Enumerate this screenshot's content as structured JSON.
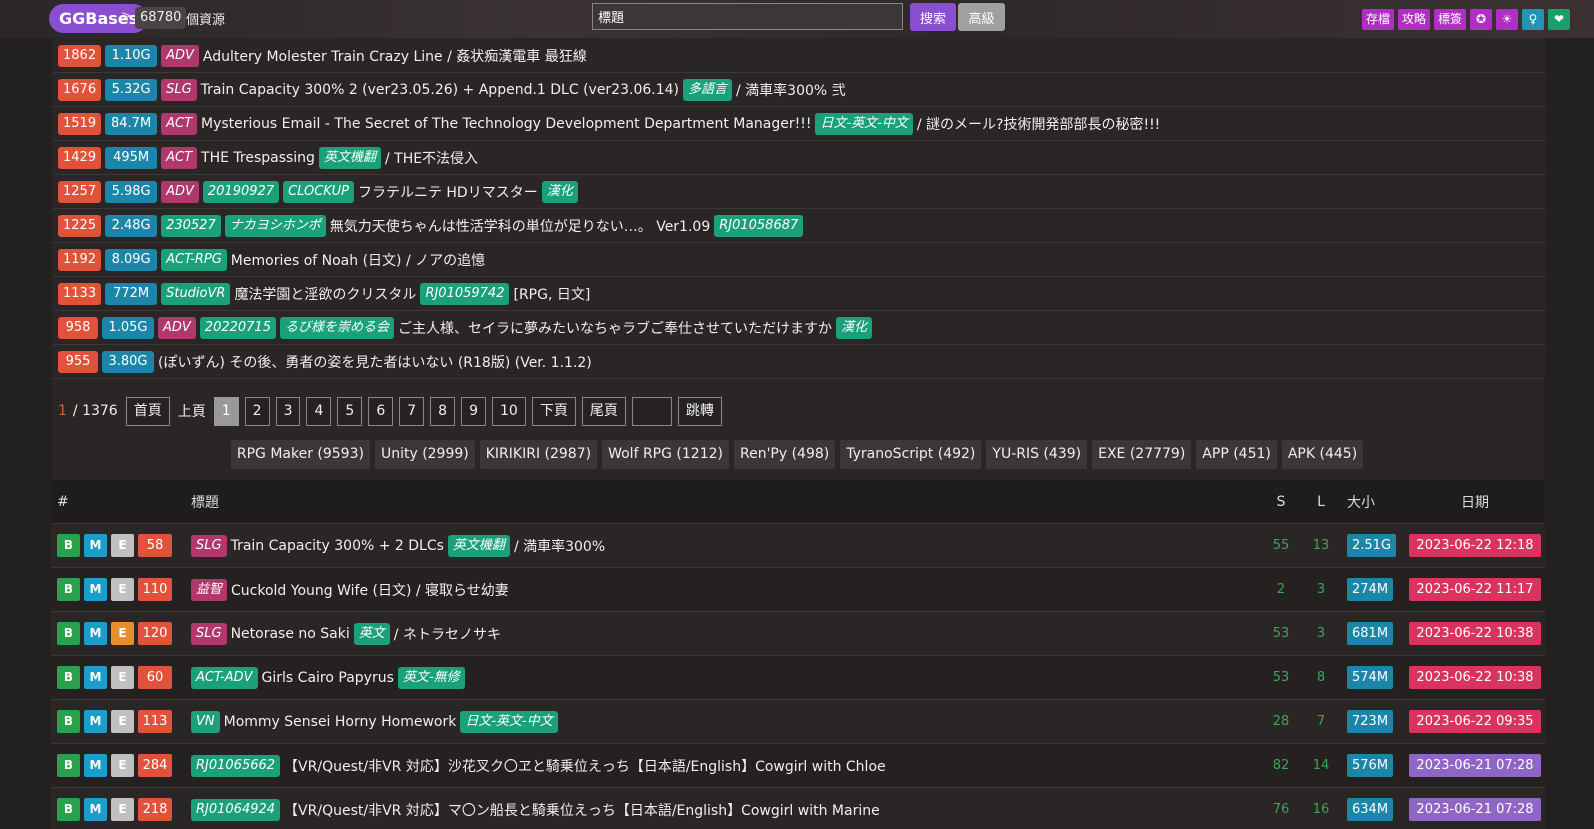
{
  "header": {
    "brand": "GGBases",
    "crumb_sep": ">",
    "resource_count": "68780",
    "resource_label": "個資源",
    "search": {
      "value": "標題",
      "placeholder": ""
    },
    "search_label": "搜索",
    "advanced_label": "高級",
    "right_buttons": [
      {
        "label": "存檔",
        "icon": "archive"
      },
      {
        "label": "攻略",
        "icon": "guide"
      },
      {
        "label": "標簽",
        "icon": "tags"
      },
      {
        "label": "✪",
        "icon": "star-circle-icon"
      },
      {
        "label": "☀",
        "icon": "sun-icon"
      },
      {
        "label": "♀",
        "icon": "female-icon"
      },
      {
        "label": "❤",
        "icon": "heart-icon"
      }
    ]
  },
  "top_list": [
    {
      "count": "1862",
      "size": "1.10G",
      "tags": [
        {
          "t": "ADV",
          "c": "pink"
        }
      ],
      "title": "Adultery Molester Train Crazy Line / 姦状痴漢電車 最狂線",
      "tags_after": [],
      "tail": ""
    },
    {
      "count": "1676",
      "size": "5.32G",
      "tags": [
        {
          "t": "SLG",
          "c": "pink"
        }
      ],
      "title": "Train Capacity 300% 2 (ver23.05.26) + Append.1 DLC (ver23.06.14)",
      "tags_after": [
        {
          "t": "多語言",
          "c": "green"
        }
      ],
      "tail": "/ 満車率300% 弐"
    },
    {
      "count": "1519",
      "size": "84.7M",
      "tags": [
        {
          "t": "ACT",
          "c": "pink"
        }
      ],
      "title": "Mysterious Email - The Secret of The Technology Development Department Manager!!!",
      "tags_after": [
        {
          "t": "日文-英文-中文",
          "c": "green"
        }
      ],
      "tail": "/ 謎のメール?技術開発部部長の秘密!!!"
    },
    {
      "count": "1429",
      "size": "495M",
      "tags": [
        {
          "t": "ACT",
          "c": "pink"
        }
      ],
      "title": "THE Trespassing",
      "tags_after": [
        {
          "t": "英文機翻",
          "c": "green"
        }
      ],
      "tail": "/ THE不法侵入"
    },
    {
      "count": "1257",
      "size": "5.98G",
      "tags": [
        {
          "t": "ADV",
          "c": "pink"
        },
        {
          "t": "20190927",
          "c": "green"
        },
        {
          "t": "CLOCKUP",
          "c": "green"
        }
      ],
      "title": "フラテルニテ HDリマスター",
      "tags_after": [
        {
          "t": "漢化",
          "c": "green"
        }
      ],
      "tail": ""
    },
    {
      "count": "1225",
      "size": "2.48G",
      "tags": [
        {
          "t": "230527",
          "c": "green"
        },
        {
          "t": "ナカヨシホンポ",
          "c": "green"
        }
      ],
      "title": "無気力天使ちゃんは性活学科の単位が足りない…。 Ver1.09",
      "tags_after": [
        {
          "t": "RJ01058687",
          "c": "green"
        }
      ],
      "tail": ""
    },
    {
      "count": "1192",
      "size": "8.09G",
      "tags": [
        {
          "t": "ACT-RPG",
          "c": "green"
        }
      ],
      "title": "Memories of Noah (日文) / ノアの追憶",
      "tags_after": [],
      "tail": ""
    },
    {
      "count": "1133",
      "size": "772M",
      "tags": [
        {
          "t": "StudioVR",
          "c": "green"
        }
      ],
      "title": "魔法学園と淫欲のクリスタル",
      "tags_after": [
        {
          "t": "RJ01059742",
          "c": "green"
        }
      ],
      "tail": "[RPG, 日文]"
    },
    {
      "count": "958",
      "size": "1.05G",
      "tags": [
        {
          "t": "ADV",
          "c": "pink"
        },
        {
          "t": "20220715",
          "c": "green"
        },
        {
          "t": "るび様を崇める会",
          "c": "green"
        }
      ],
      "title": "ご主人様、セイラに夢みたいなちゃラブご奉仕させていただけますか",
      "tags_after": [
        {
          "t": "漢化",
          "c": "green"
        }
      ],
      "tail": ""
    },
    {
      "count": "955",
      "size": "3.80G",
      "tags": [],
      "title": "(ぽいずん) その後、勇者の姿を見た者はいない (R18版) (Ver. 1.1.2)",
      "tags_after": [],
      "tail": ""
    }
  ],
  "pager": {
    "current": "1",
    "total": "/ 1376",
    "first": "首頁",
    "prev": "上頁",
    "pages": [
      "1",
      "2",
      "3",
      "4",
      "5",
      "6",
      "7",
      "8",
      "9",
      "10"
    ],
    "next": "下頁",
    "last": "尾頁",
    "jump_value": "",
    "jump": "跳轉"
  },
  "engines": [
    "RPG Maker (9593)",
    "Unity (2999)",
    "KIRIKIRI (2987)",
    "Wolf RPG (1212)",
    "Ren'Py (498)",
    "TyranoScript (492)",
    "YU-RIS (439)",
    "EXE (27779)",
    "APP (451)",
    "APK (445)"
  ],
  "table": {
    "headers": {
      "num": "#",
      "title": "標題",
      "s": "S",
      "l": "L",
      "size": "大小",
      "date": "日期"
    },
    "rows": [
      {
        "b": "B",
        "m": "M",
        "e": "E",
        "e_orange": false,
        "count": "58",
        "tags": [
          {
            "t": "SLG",
            "c": "pink"
          }
        ],
        "title": "Train Capacity 300% + 2 DLCs",
        "tags_after": [
          {
            "t": "英文機翻",
            "c": "green"
          }
        ],
        "tail": "/ 満車率300%",
        "s": "55",
        "l": "13",
        "size": "2.51G",
        "date": "2023-06-22 12:18",
        "date_color": "pink"
      },
      {
        "b": "B",
        "m": "M",
        "e": "E",
        "e_orange": false,
        "count": "110",
        "tags": [
          {
            "t": "益智",
            "c": "pink"
          }
        ],
        "title": "Cuckold Young Wife (日文) / 寝取らせ幼妻",
        "tags_after": [],
        "tail": "",
        "s": "2",
        "l": "3",
        "size": "274M",
        "date": "2023-06-22 11:17",
        "date_color": "pink"
      },
      {
        "b": "B",
        "m": "M",
        "e": "E",
        "e_orange": true,
        "count": "120",
        "tags": [
          {
            "t": "SLG",
            "c": "pink"
          }
        ],
        "title": "Netorase no Saki",
        "tags_after": [
          {
            "t": "英文",
            "c": "green"
          }
        ],
        "tail": "/ ネトラセノサキ",
        "s": "53",
        "l": "3",
        "size": "681M",
        "date": "2023-06-22 10:38",
        "date_color": "pink"
      },
      {
        "b": "B",
        "m": "M",
        "e": "E",
        "e_orange": false,
        "count": "60",
        "tags": [
          {
            "t": "ACT-ADV",
            "c": "green"
          }
        ],
        "title": "Girls Cairo Papyrus",
        "tags_after": [
          {
            "t": "英文-無修",
            "c": "green"
          }
        ],
        "tail": "",
        "s": "53",
        "l": "8",
        "size": "574M",
        "date": "2023-06-22 10:38",
        "date_color": "pink"
      },
      {
        "b": "B",
        "m": "M",
        "e": "E",
        "e_orange": false,
        "count": "113",
        "tags": [
          {
            "t": "VN",
            "c": "green"
          }
        ],
        "title": "Mommy Sensei Horny Homework",
        "tags_after": [
          {
            "t": "日文-英文-中文",
            "c": "green"
          }
        ],
        "tail": "",
        "s": "28",
        "l": "7",
        "size": "723M",
        "date": "2023-06-22 09:35",
        "date_color": "pink"
      },
      {
        "b": "B",
        "m": "M",
        "e": "E",
        "e_orange": false,
        "count": "284",
        "tags": [
          {
            "t": "RJ01065662",
            "c": "green"
          }
        ],
        "title": "【VR/Quest/非VR 対応】沙花叉ク〇ヱと騎乗位えっち【日本語/English】Cowgirl with Chloe",
        "tags_after": [],
        "tail": "",
        "s": "82",
        "l": "14",
        "size": "576M",
        "date": "2023-06-21 07:28",
        "date_color": "purple"
      },
      {
        "b": "B",
        "m": "M",
        "e": "E",
        "e_orange": false,
        "count": "218",
        "tags": [
          {
            "t": "RJ01064924",
            "c": "green"
          }
        ],
        "title": "【VR/Quest/非VR 対応】マ〇ン船長と騎乗位えっち【日本語/English】Cowgirl with Marine",
        "tags_after": [],
        "tail": "",
        "s": "76",
        "l": "16",
        "size": "634M",
        "date": "2023-06-21 07:28",
        "date_color": "purple"
      }
    ]
  }
}
